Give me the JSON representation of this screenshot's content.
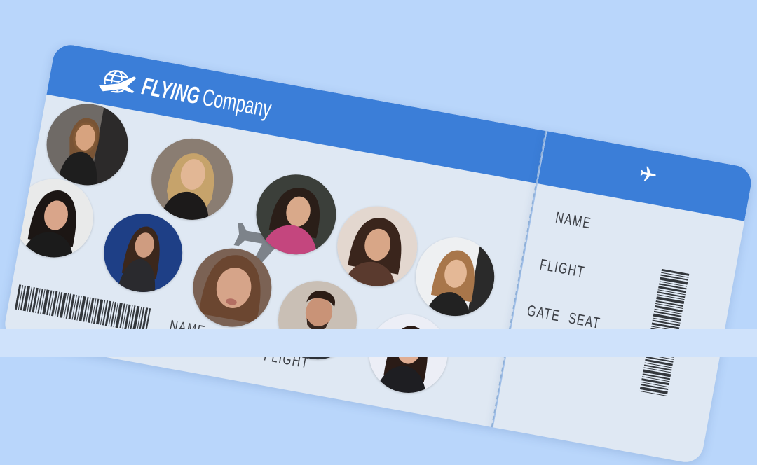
{
  "ticket": {
    "brand": {
      "bold": "FLYING",
      "light": "Company"
    },
    "fields": {
      "name": "NAME",
      "flight": "FLIGHT",
      "gate": "GATE",
      "seat": "SEAT"
    }
  },
  "colors": {
    "header": "#3b7ed8",
    "ticket": "#dfe8f3",
    "background": "#b9d6fb",
    "plane": "#7d838a"
  },
  "icons": [
    "globe-plane-logo-icon",
    "airplane-icon",
    "barcode-icon"
  ]
}
